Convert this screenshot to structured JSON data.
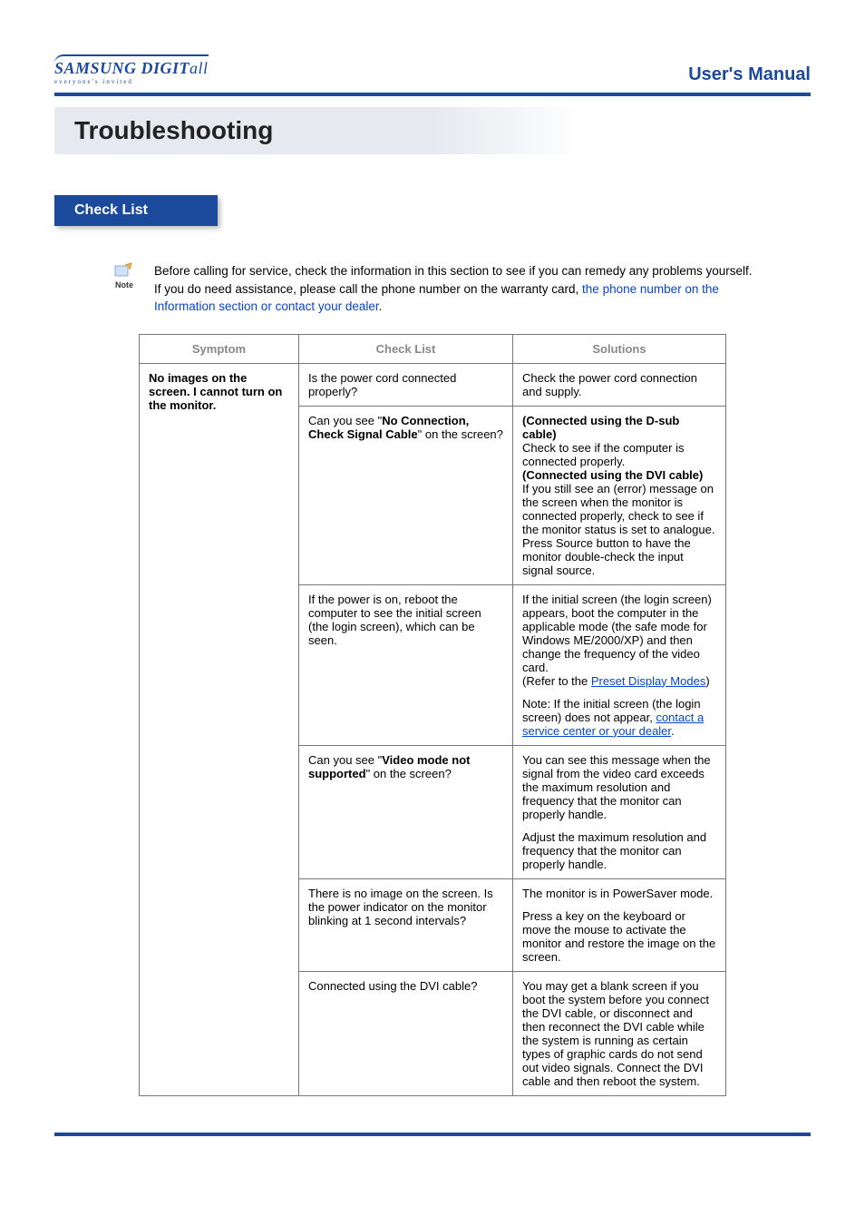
{
  "header": {
    "logo_main": "SAMSUNG DIGIT",
    "logo_italic": "all",
    "logo_sub": "everyone's invited",
    "manual_title": "User's Manual"
  },
  "page_title": "Troubleshooting",
  "section_tab": "Check List",
  "note": {
    "icon_label": "Note",
    "text_prefix": "Before calling for service, check the information in this section to see if you can remedy any problems yourself. If you do need assistance, please call the phone number on the warranty card, ",
    "link_text": "the phone number on the Information section or contact your dealer",
    "suffix": "."
  },
  "table": {
    "headers": [
      "Symptom",
      "Check List",
      "Solutions"
    ],
    "symptom": "No images on the screen. I cannot turn on the monitor.",
    "rows": [
      {
        "check": "Is the power cord connected properly?",
        "solution": "Check the power cord connection and supply."
      },
      {
        "check_pre": "Can you see \"",
        "check_bold": "No Connection, Check Signal Cable",
        "check_post": "\" on the screen?",
        "solution_parts": [
          {
            "bold": "(Connected using the D-sub cable)"
          },
          {
            "plain": "Check to see if the computer is connected properly."
          },
          {
            "bold": "(Connected using the DVI cable)"
          },
          {
            "plain": "If you still see an (error) message on the screen when the monitor is connected properly, check to see if the monitor status is set to analogue. Press Source button to have the monitor double-check the input signal source."
          }
        ]
      },
      {
        "check": "If the power is on, reboot the computer to see the initial screen (the login screen), which can be seen.",
        "solution_p1_pre": "If the initial screen (the login screen) appears, boot the computer in the applicable mode (the safe mode for Windows ME/2000/XP) and then change the frequency of the video card.",
        "solution_p1_refer": "(Refer to the ",
        "solution_p1_link": "Preset Display Modes",
        "solution_p1_end": ")",
        "solution_p2_pre": "Note: If the initial screen (the login screen) does not appear, ",
        "solution_p2_link": "contact a service center or your dealer",
        "solution_p2_end": "."
      },
      {
        "check_pre": "Can you see \"",
        "check_bold": "Video mode not supported",
        "check_post": "\" on the screen?",
        "solution_p1": "You can see this message when the signal from the video card exceeds the maximum resolution and frequency that the monitor can properly handle.",
        "solution_p2": "Adjust the maximum resolution and frequency that the monitor can properly handle."
      },
      {
        "check": "There is no image on the screen. Is the power indicator on the monitor blinking at 1 second intervals?",
        "solution_p1": "The monitor is in PowerSaver mode.",
        "solution_p2": "Press a key on the keyboard or move the mouse to activate the monitor and restore the image on the screen."
      },
      {
        "check": "Connected using the DVI cable?",
        "solution": "You may get a blank screen if you boot the system before you connect the DVI cable, or disconnect and then reconnect the DVI cable while the system is running as certain types of graphic cards do not send out video signals. Connect the DVI cable and then reboot the system."
      }
    ]
  }
}
